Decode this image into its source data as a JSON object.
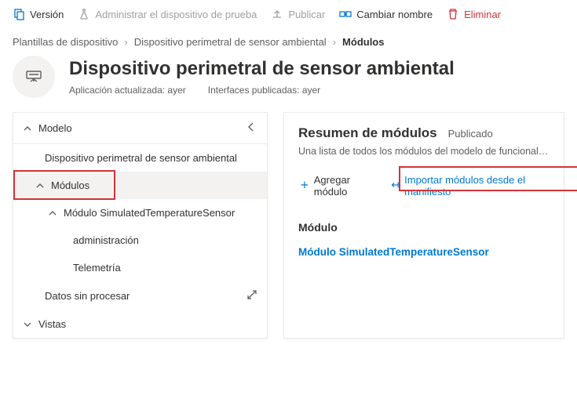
{
  "toolbar": {
    "version": "Versión",
    "manage_device": "Administrar el dispositivo de prueba",
    "publish": "Publicar",
    "rename": "Cambiar nombre",
    "delete": "Eliminar"
  },
  "breadcrumb": {
    "root": "Plantillas de dispositivo",
    "mid": "Dispositivo perimetral de sensor ambiental",
    "leaf": "Módulos"
  },
  "header": {
    "title": "Dispositivo perimetral de sensor ambiental",
    "app_updated": "Aplicación actualizada: ayer",
    "interfaces_published": "Interfaces publicadas: ayer"
  },
  "tree": {
    "root": "Modelo",
    "device": "Dispositivo perimetral de sensor ambiental",
    "modules": "Módulos",
    "module_item": "Módulo SimulatedTemperatureSensor",
    "admin": "administración",
    "telemetry": "Telemetría",
    "raw_data": "Datos sin procesar",
    "views": "Vistas"
  },
  "summary": {
    "title": "Resumen de módulos",
    "status": "Publicado",
    "desc": "Una lista de todos los módulos del modelo de funcionalidad del...",
    "add": "Agregar módulo",
    "import": "Importar módulos desde el manifiesto",
    "section_title": "Módulo",
    "module_link": "Módulo SimulatedTemperatureSensor"
  }
}
